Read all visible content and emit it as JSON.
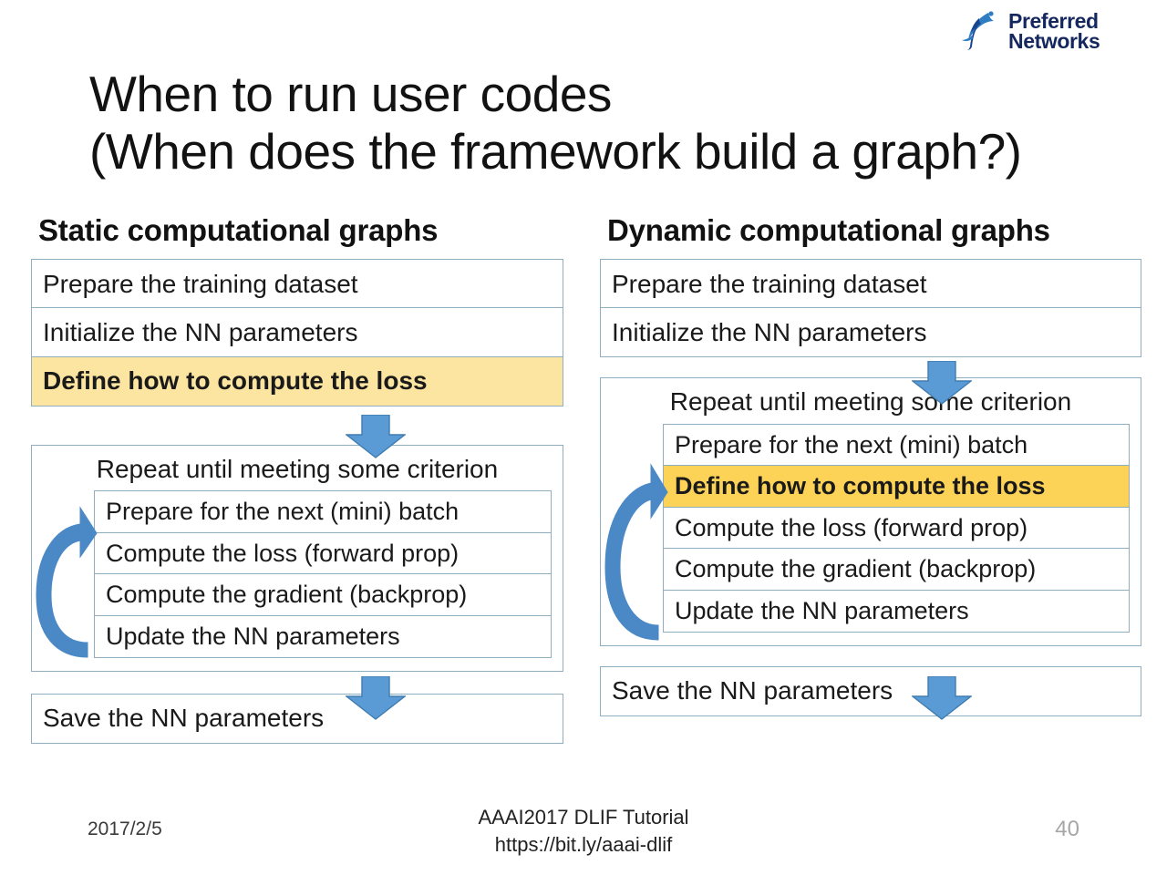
{
  "logo": {
    "line1": "Preferred",
    "line2": "Networks",
    "mark": "pn-swoosh-logo",
    "color": "#15275f",
    "mark_color": "#2f7ec4"
  },
  "title": {
    "line1": "When to run user codes",
    "line2": "(When does the framework build a graph?)"
  },
  "colors": {
    "box_border": "#8fafc0",
    "arrow_fill": "#5b9bd5",
    "arrow_stroke": "#3f7cb0",
    "highlight_left": "#fce5a0",
    "highlight_right": "#fcd257",
    "page_number": "#a6a6a6"
  },
  "columns": [
    {
      "heading": "Static computational graphs",
      "steps_before": [
        {
          "label": "Prepare the training dataset",
          "highlight": false
        },
        {
          "label": "Initialize the NN parameters",
          "highlight": false
        },
        {
          "label": "Define how to compute the loss",
          "highlight": true
        }
      ],
      "loop": {
        "label": "Repeat until meeting some criterion",
        "steps": [
          {
            "label": "Prepare for the next (mini) batch",
            "highlight": false
          },
          {
            "label": "Compute the loss (forward prop)",
            "highlight": false
          },
          {
            "label": "Compute the gradient (backprop)",
            "highlight": false
          },
          {
            "label": "Update the NN parameters",
            "highlight": false
          }
        ]
      },
      "steps_after": [
        {
          "label": "Save the NN parameters",
          "highlight": false
        }
      ]
    },
    {
      "heading": "Dynamic computational graphs",
      "steps_before": [
        {
          "label": "Prepare the training dataset",
          "highlight": false
        },
        {
          "label": "Initialize the NN parameters",
          "highlight": false
        }
      ],
      "loop": {
        "label": "Repeat until meeting some criterion",
        "steps": [
          {
            "label": "Prepare for the next (mini) batch",
            "highlight": false
          },
          {
            "label": "Define how to compute the loss",
            "highlight": true
          },
          {
            "label": "Compute the loss (forward prop)",
            "highlight": false
          },
          {
            "label": "Compute the gradient (backprop)",
            "highlight": false
          },
          {
            "label": "Update the NN parameters",
            "highlight": false
          }
        ]
      },
      "steps_after": [
        {
          "label": "Save the NN parameters",
          "highlight": false
        }
      ]
    }
  ],
  "footer": {
    "date": "2017/2/5",
    "event": "AAAI2017 DLIF Tutorial",
    "url": "https://bit.ly/aaai-dlif",
    "page_number": "40"
  }
}
